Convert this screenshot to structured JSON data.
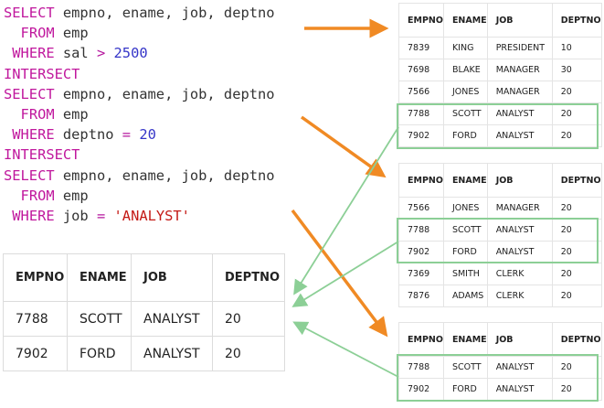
{
  "sql": {
    "q1_select": "SELECT",
    "q1_cols": " empno, ename, job, deptno",
    "q1_from": "FROM",
    "q1_table": " emp",
    "q1_where": "WHERE",
    "q1_field": " sal ",
    "q1_op": ">",
    "q1_val": "2500",
    "intersect1": "INTERSECT",
    "q2_select": "SELECT",
    "q2_cols": " empno, ename, job, deptno",
    "q2_from": "FROM",
    "q2_table": " emp",
    "q2_where": "WHERE",
    "q2_field": " deptno ",
    "q2_op": "=",
    "q2_val": "20",
    "intersect2": "INTERSECT",
    "q3_select": "SELECT",
    "q3_cols": " empno, ename, job, deptno",
    "q3_from": "FROM",
    "q3_table": " emp",
    "q3_where": "WHERE",
    "q3_field": " job ",
    "q3_op": "=",
    "q3_val": "'ANALYST'"
  },
  "headers": [
    "EMPNO",
    "ENAME",
    "JOB",
    "DEPTNO"
  ],
  "table1": [
    [
      "7839",
      "KING",
      "PRESIDENT",
      "10"
    ],
    [
      "7698",
      "BLAKE",
      "MANAGER",
      "30"
    ],
    [
      "7566",
      "JONES",
      "MANAGER",
      "20"
    ],
    [
      "7788",
      "SCOTT",
      "ANALYST",
      "20"
    ],
    [
      "7902",
      "FORD",
      "ANALYST",
      "20"
    ]
  ],
  "table2": [
    [
      "7566",
      "JONES",
      "MANAGER",
      "20"
    ],
    [
      "7788",
      "SCOTT",
      "ANALYST",
      "20"
    ],
    [
      "7902",
      "FORD",
      "ANALYST",
      "20"
    ],
    [
      "7369",
      "SMITH",
      "CLERK",
      "20"
    ],
    [
      "7876",
      "ADAMS",
      "CLERK",
      "20"
    ]
  ],
  "table3": [
    [
      "7788",
      "SCOTT",
      "ANALYST",
      "20"
    ],
    [
      "7902",
      "FORD",
      "ANALYST",
      "20"
    ]
  ],
  "result": [
    [
      "7788",
      "SCOTT",
      "ANALYST",
      "20"
    ],
    [
      "7902",
      "FORD",
      "ANALYST",
      "20"
    ]
  ],
  "colors": {
    "keyword": "#c0179d",
    "number": "#3535c8",
    "string": "#c41a16",
    "arrow_orange": "#f08a24",
    "arrow_green": "#8ccf96"
  }
}
